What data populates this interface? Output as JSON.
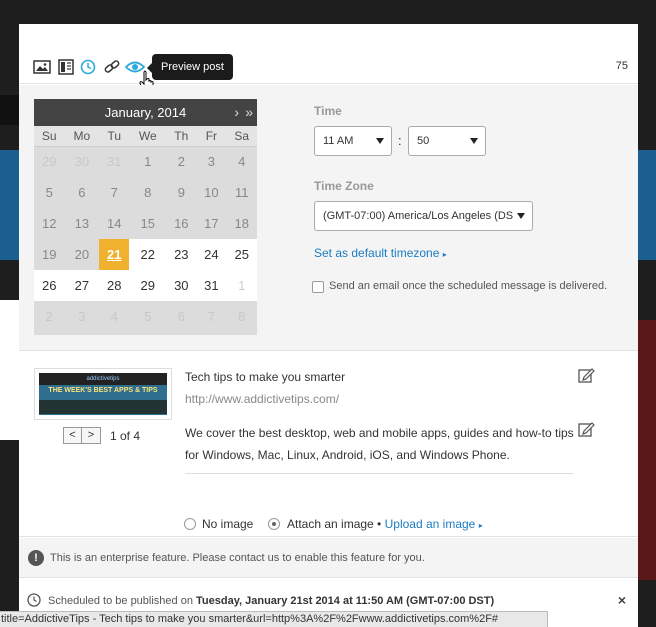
{
  "toolbar": {
    "icons": [
      "image-icon",
      "layout-icon",
      "clock-icon",
      "link-icon",
      "eye-icon"
    ],
    "tooltip": "Preview post",
    "char_count": "75"
  },
  "calendar": {
    "title": "January, 2014",
    "weekdays": [
      "Su",
      "Mo",
      "Tu",
      "We",
      "Th",
      "Fr",
      "Sa"
    ],
    "weeks": [
      [
        "29",
        "30",
        "31",
        "1",
        "2",
        "3",
        "4"
      ],
      [
        "5",
        "6",
        "7",
        "8",
        "9",
        "10",
        "11"
      ],
      [
        "12",
        "13",
        "14",
        "15",
        "16",
        "17",
        "18"
      ],
      [
        "19",
        "20",
        "21",
        "22",
        "23",
        "24",
        "25"
      ],
      [
        "26",
        "27",
        "28",
        "29",
        "30",
        "31",
        "1"
      ],
      [
        "2",
        "3",
        "4",
        "5",
        "6",
        "7",
        "8"
      ]
    ],
    "selected": "21"
  },
  "time": {
    "label": "Time",
    "hour": "11 AM",
    "minute": "50",
    "separator": ":"
  },
  "timezone": {
    "label": "Time Zone",
    "value": "(GMT-07:00) America/Los Angeles (DS",
    "default_link": "Set as default timezone",
    "arrow": "▸"
  },
  "email_option": {
    "label": "Send an email once the scheduled message is delivered.",
    "checked": false
  },
  "preview": {
    "thumb_brand": "addictivetips",
    "thumb_headline": "THE WEEK'S BEST APPS & TIPS",
    "pager_prev": "<",
    "pager_next": ">",
    "pager_text": "1 of 4",
    "title": "Tech tips to make you smarter",
    "url": "http://www.addictivetips.com/",
    "description": "We cover the best desktop, web and mobile apps, guides and how-to tips for Windows, Mac, Linux, Android, iOS, and Windows Phone.",
    "no_image_label": "No image",
    "attach_label": "Attach an image •",
    "upload_link": "Upload an image",
    "upload_arrow": "▸"
  },
  "notice": {
    "icon": "!",
    "text": "This is an enterprise feature. Please contact us to enable this feature for you."
  },
  "schedule": {
    "prefix": "Scheduled to be published on",
    "date": "Tuesday, January 21st 2014 at 11:50 AM (GMT-07:00 DST)",
    "close": "×"
  },
  "statusbar": {
    "url": "title=AddictiveTips - Tech tips to make you smarter&url=http%3A%2F%2Fwww.addictivetips.com%2F#"
  },
  "colors": {
    "accent": "#1b7cc1",
    "selected_day": "#f0b22e",
    "icon_active": "#2eaadc"
  }
}
